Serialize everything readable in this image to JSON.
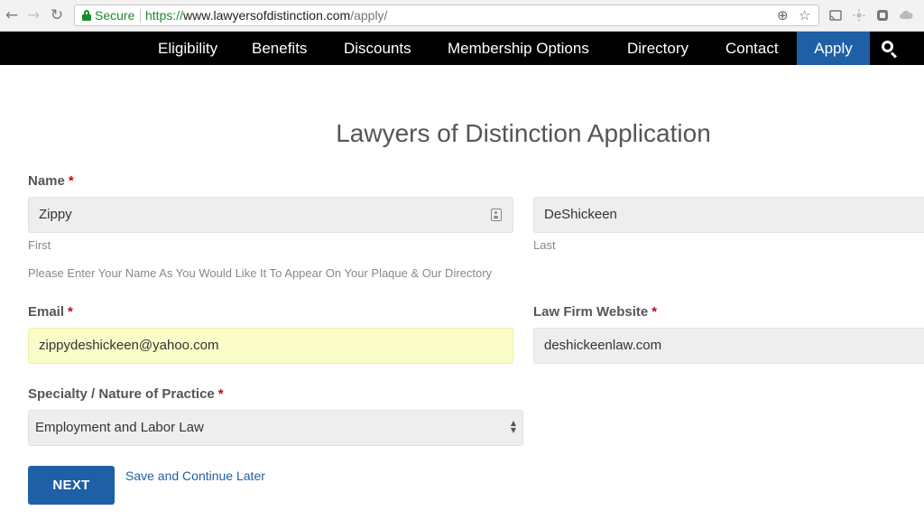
{
  "browser": {
    "secure_label": "Secure",
    "url": {
      "scheme": "https://",
      "host": "www.lawyersofdistinction.com",
      "path": "/apply/"
    }
  },
  "site_nav": {
    "items": [
      {
        "label": "Eligibility"
      },
      {
        "label": "Benefits"
      },
      {
        "label": "Discounts"
      },
      {
        "label": "Membership Options"
      },
      {
        "label": "Directory"
      },
      {
        "label": "Contact"
      },
      {
        "label": "Apply"
      }
    ],
    "colors": {
      "bar": "#000000",
      "active": "#1f5fa6"
    }
  },
  "form": {
    "title": "Lawyers of Distinction Application",
    "required_mark": "*",
    "name": {
      "label": "Name",
      "first_value": "Zippy",
      "first_sublabel": "First",
      "last_value": "DeShickeen",
      "last_sublabel": "Last",
      "help": "Please Enter Your Name As You Would Like It To Appear On Your Plaque & Our Directory"
    },
    "email": {
      "label": "Email",
      "value": "zippydeshickeen@yahoo.com"
    },
    "website": {
      "label": "Law Firm Website",
      "value": "deshickeenlaw.com"
    },
    "specialty": {
      "label": "Specialty / Nature of Practice",
      "selected": "Employment and Labor Law"
    },
    "next_label": "NEXT",
    "save_label": "Save and Continue Later"
  }
}
